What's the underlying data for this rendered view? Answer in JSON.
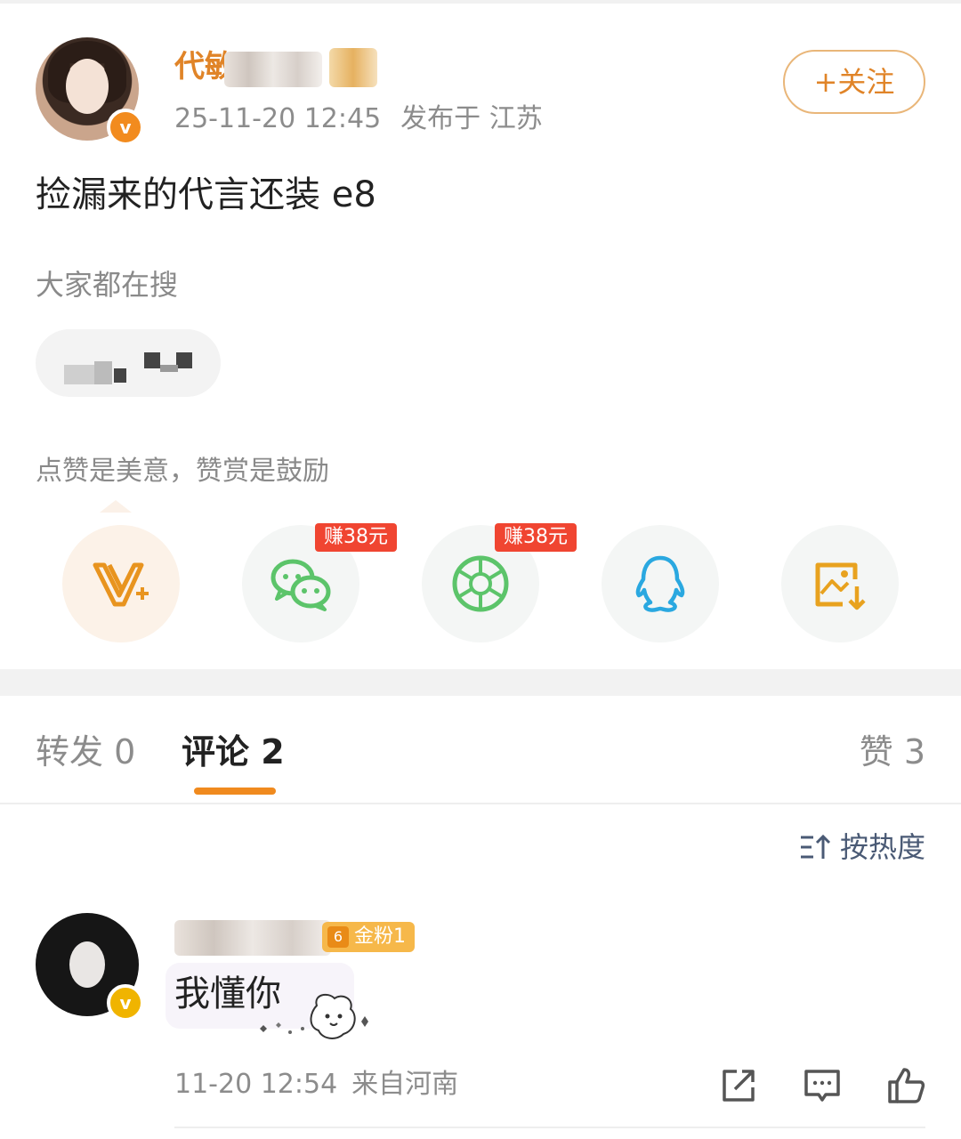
{
  "post": {
    "author_name": "代敏",
    "timestamp": "25-11-20 12:45",
    "location": "发布于 江苏",
    "follow_label": "+关注",
    "text": "捡漏来的代言还装 e8",
    "verified_mark": "v"
  },
  "search": {
    "label": "大家都在搜"
  },
  "reward": {
    "hint": "点赞是美意，赞赏是鼓励"
  },
  "share": {
    "items": [
      {
        "icon": "vplus-icon"
      },
      {
        "icon": "wechat-icon",
        "badge": "赚38元"
      },
      {
        "icon": "moments-icon",
        "badge": "赚38元"
      },
      {
        "icon": "qq-icon"
      },
      {
        "icon": "save-image-icon"
      }
    ]
  },
  "tabs": {
    "repost": "转发 0",
    "comment": "评论 2",
    "likes": "赞 3"
  },
  "sort": {
    "label": "按热度"
  },
  "comment": {
    "badge": "金粉1",
    "level": "6",
    "verified_mark": "v",
    "text": "我懂你",
    "time": "11-20 12:54",
    "origin": "来自河南"
  },
  "colors": {
    "accent": "#f08a1e",
    "earn_badge": "#f04531",
    "wechat": "#5cc46a",
    "qq": "#2aa8e0",
    "sort": "#4a5a75"
  }
}
